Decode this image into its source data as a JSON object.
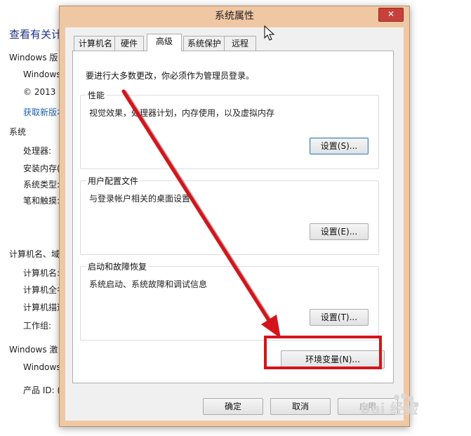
{
  "background": {
    "heading": "查看有关计",
    "windows_edition_label": "Windows 版",
    "windows_name": "Windows",
    "copyright": "© 2013 M",
    "get_more": "获取新版本",
    "system_section": "系统",
    "system_rows": [
      "处理器:",
      "安装内存(",
      "系统类型:",
      "笔和触摸:"
    ],
    "computer_section": "计算机名、域",
    "computer_rows": [
      "计算机名:",
      "计算机全名",
      "计算机描述",
      "工作组:"
    ],
    "activation_section": "Windows 激",
    "activation_name": "Windows",
    "product_id": "产品 ID: ("
  },
  "dialog": {
    "title": "系统属性",
    "close_glyph": "✕",
    "tabs": [
      {
        "label": "计算机名"
      },
      {
        "label": "硬件"
      },
      {
        "label": "高级"
      },
      {
        "label": "系统保护"
      },
      {
        "label": "远程"
      }
    ],
    "note": "要进行大多数更改，你必须作为管理员登录。",
    "performance": {
      "label": "性能",
      "desc": "视觉效果，处理器计划，内存使用，以及虚拟内存",
      "button": "设置(S)..."
    },
    "profiles": {
      "label": "用户配置文件",
      "desc": "与登录帐户相关的桌面设置",
      "button": "设置(E)..."
    },
    "startup": {
      "label": "启动和故障恢复",
      "desc": "系统启动、系统故障和调试信息",
      "button": "设置(T)..."
    },
    "env_button": "环境变量(N)...",
    "ok": "确定",
    "cancel": "取消",
    "apply": "应用"
  },
  "watermark": {
    "text": "Bai 经验",
    "colors": {
      "text": "#d8d8d8"
    }
  },
  "colors": {
    "annotation": "#d3151b",
    "titlebar": "#f0c7a3",
    "close": "#c7403a"
  }
}
